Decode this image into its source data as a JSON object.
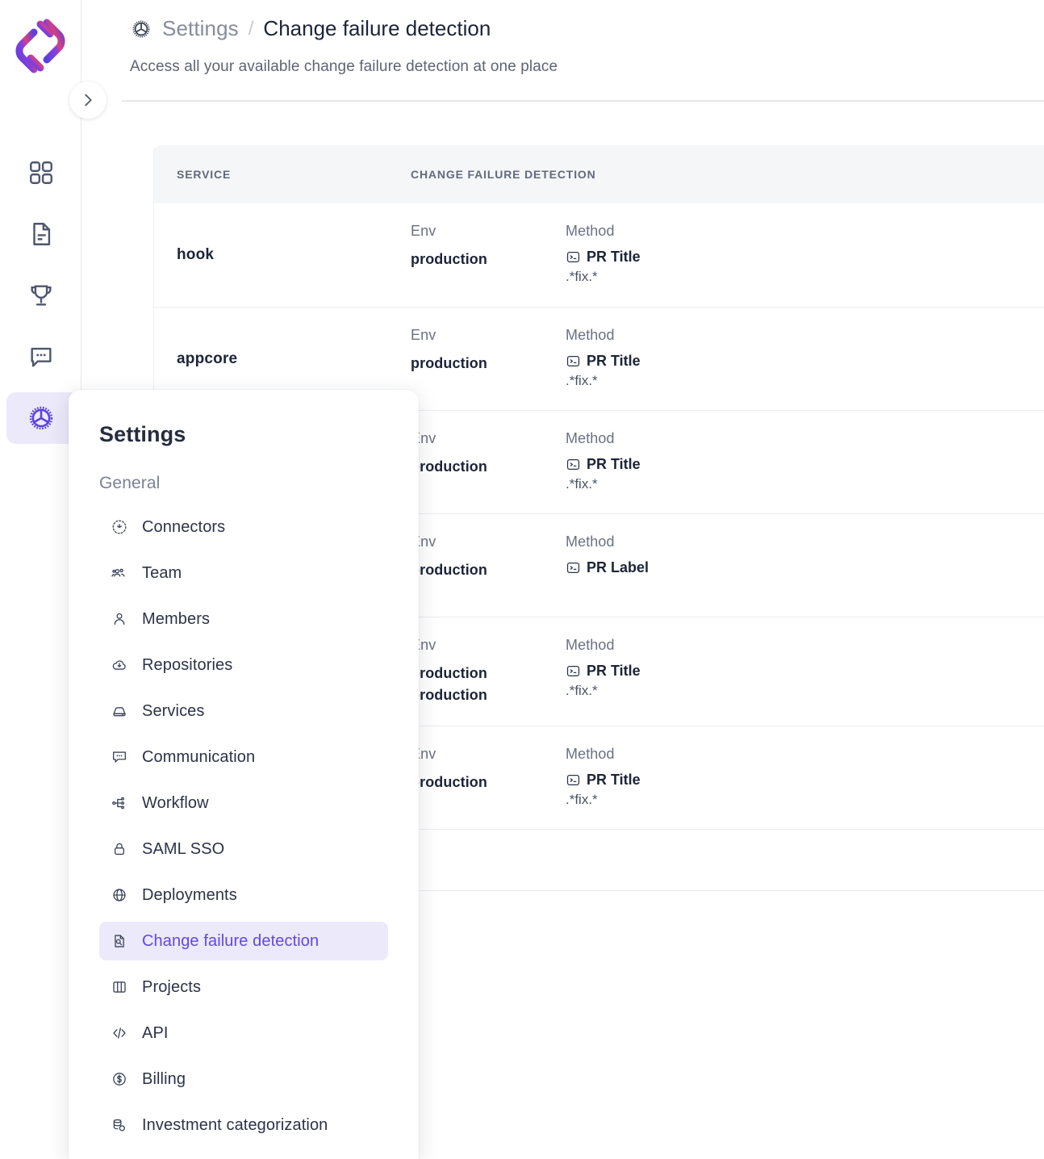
{
  "brand": {
    "logo_name": "app-logo",
    "accent": "#6246e8",
    "accent_soft": "#ece9fa"
  },
  "rail": {
    "collapse_icon": "chevron-right-icon",
    "items": [
      {
        "name": "dashboard",
        "icon": "grid-icon",
        "active": false
      },
      {
        "name": "reports",
        "icon": "document-icon",
        "active": false
      },
      {
        "name": "goals",
        "icon": "trophy-icon",
        "active": false
      },
      {
        "name": "feedback",
        "icon": "chat-bubble-icon",
        "active": false
      },
      {
        "name": "settings",
        "icon": "gear-icon",
        "active": true
      }
    ]
  },
  "header": {
    "gear_icon": "gear-icon",
    "breadcrumb_parent": "Settings",
    "breadcrumb_separator": "/",
    "breadcrumb_current": "Change failure detection",
    "subtitle": "Access all your available change failure detection at one place"
  },
  "table": {
    "columns": [
      "SERVICE",
      "CHANGE FAILURE DETECTION"
    ],
    "group_labels": {
      "env": "Env",
      "method": "Method"
    },
    "method_icon": "terminal-icon",
    "rows": [
      {
        "service": "hook",
        "envs": [
          "production"
        ],
        "method": "PR Title",
        "regex": ".*fix.*"
      },
      {
        "service": "appcore",
        "envs": [
          "production"
        ],
        "method": "PR Title",
        "regex": ".*fix.*"
      },
      {
        "service": "",
        "envs": [
          "production"
        ],
        "method": "PR Title",
        "regex": ".*fix.*"
      },
      {
        "service": "",
        "envs": [
          "production"
        ],
        "method": "PR Label",
        "regex": ""
      },
      {
        "service": "",
        "envs": [
          "production",
          "production"
        ],
        "method": "PR Title",
        "regex": ".*fix.*"
      },
      {
        "service": "",
        "envs": [
          "production"
        ],
        "method": "PR Title",
        "regex": ".*fix.*"
      },
      {
        "service": "",
        "envs": [],
        "method": "",
        "regex": ""
      }
    ]
  },
  "flyout": {
    "title": "Settings",
    "section": "General",
    "items": [
      {
        "label": "Connectors",
        "icon": "connectors-icon",
        "active": false
      },
      {
        "label": "Team",
        "icon": "team-icon",
        "active": false
      },
      {
        "label": "Members",
        "icon": "user-icon",
        "active": false
      },
      {
        "label": "Repositories",
        "icon": "cloud-download-icon",
        "active": false
      },
      {
        "label": "Services",
        "icon": "server-icon",
        "active": false
      },
      {
        "label": "Communication",
        "icon": "chat-bubble-icon",
        "active": false
      },
      {
        "label": "Workflow",
        "icon": "workflow-icon",
        "active": false
      },
      {
        "label": "SAML SSO",
        "icon": "lock-icon",
        "active": false
      },
      {
        "label": "Deployments",
        "icon": "globe-icon",
        "active": false
      },
      {
        "label": "Change failure detection",
        "icon": "file-search-icon",
        "active": true
      },
      {
        "label": "Projects",
        "icon": "columns-icon",
        "active": false
      },
      {
        "label": "API",
        "icon": "code-icon",
        "active": false
      },
      {
        "label": "Billing",
        "icon": "dollar-circle-icon",
        "active": false
      },
      {
        "label": "Investment categorization",
        "icon": "database-icon",
        "active": false
      }
    ]
  }
}
